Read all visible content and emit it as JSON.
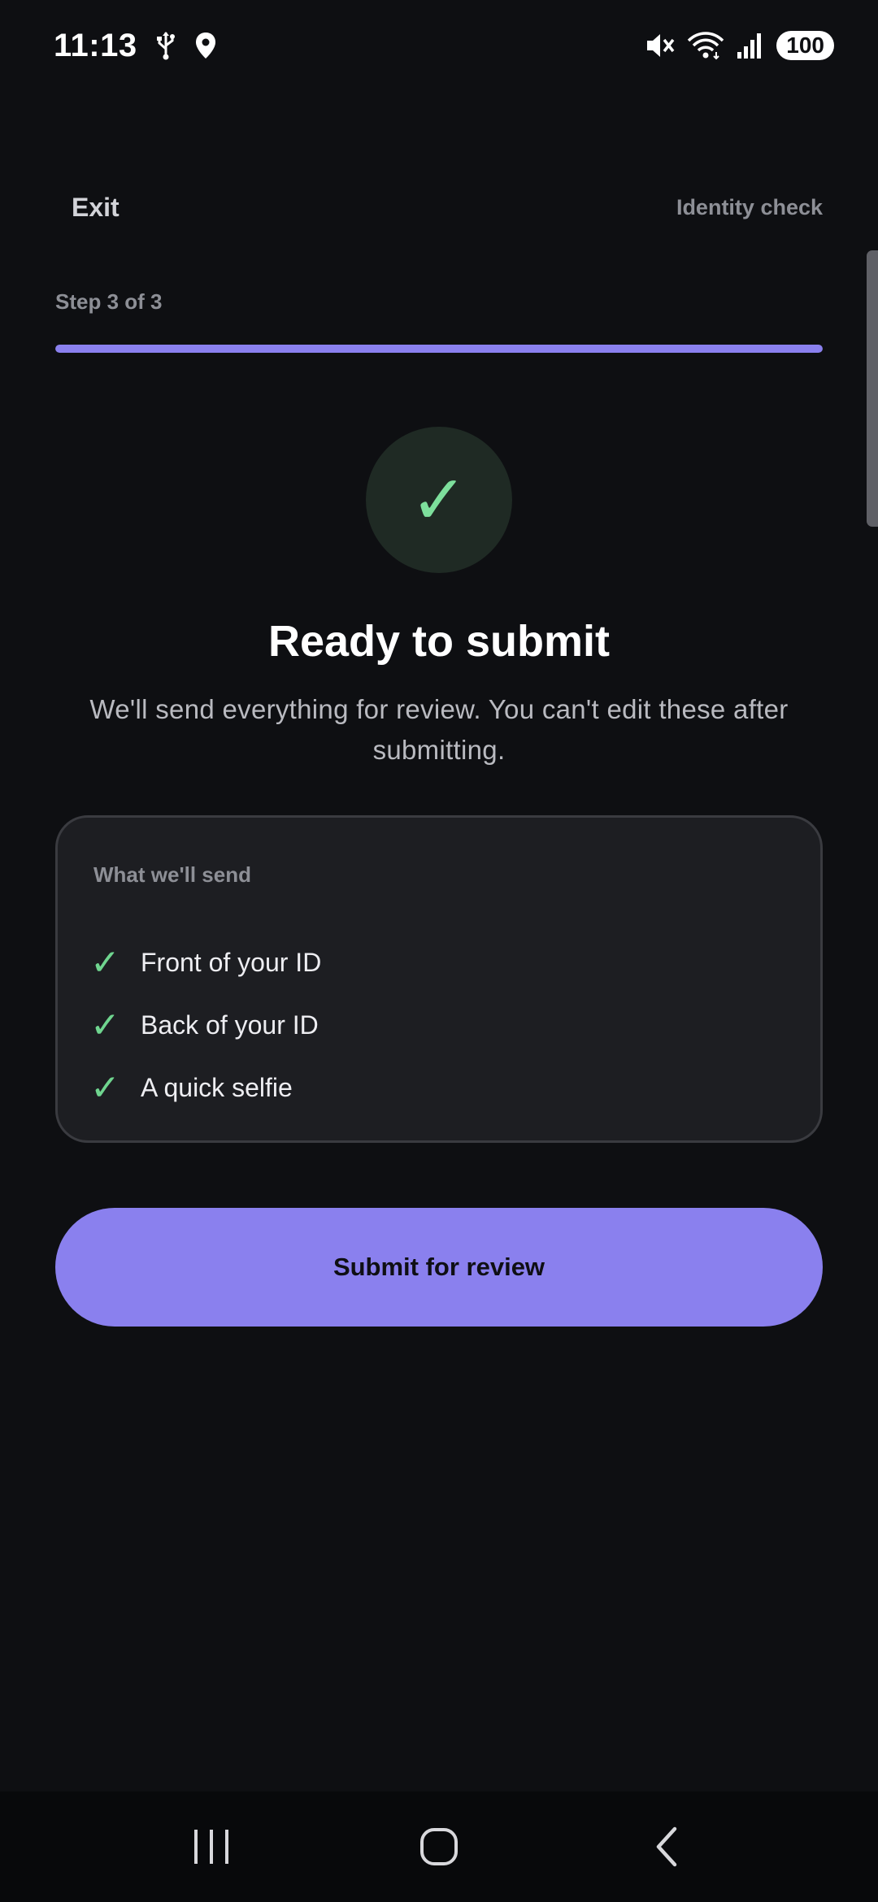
{
  "status_bar": {
    "time": "11:13",
    "battery": "100",
    "icons": [
      "usb-icon",
      "location-icon",
      "mute-icon",
      "wifi-icon",
      "signal-icon"
    ]
  },
  "header": {
    "exit_label": "Exit",
    "title": "Identity check"
  },
  "progress": {
    "step_label": "Step 3 of 3",
    "fraction": 1.0
  },
  "hero": {
    "check_glyph": "✓",
    "title": "Ready to submit",
    "subtitle": "We'll send everything for review. You can't edit these after submitting."
  },
  "card": {
    "heading": "What we'll send",
    "items": [
      {
        "check": "✓",
        "label": "Front of your ID"
      },
      {
        "check": "✓",
        "label": "Back of your ID"
      },
      {
        "check": "✓",
        "label": "A quick selfie"
      }
    ]
  },
  "submit_label": "Submit for review",
  "colors": {
    "background": "#0e0f12",
    "accent": "#8a80ee",
    "success": "#6fd58f",
    "card": "#1d1e22"
  },
  "nav_bar": {
    "icons": [
      "recent-apps-icon",
      "home-icon",
      "back-icon"
    ]
  }
}
